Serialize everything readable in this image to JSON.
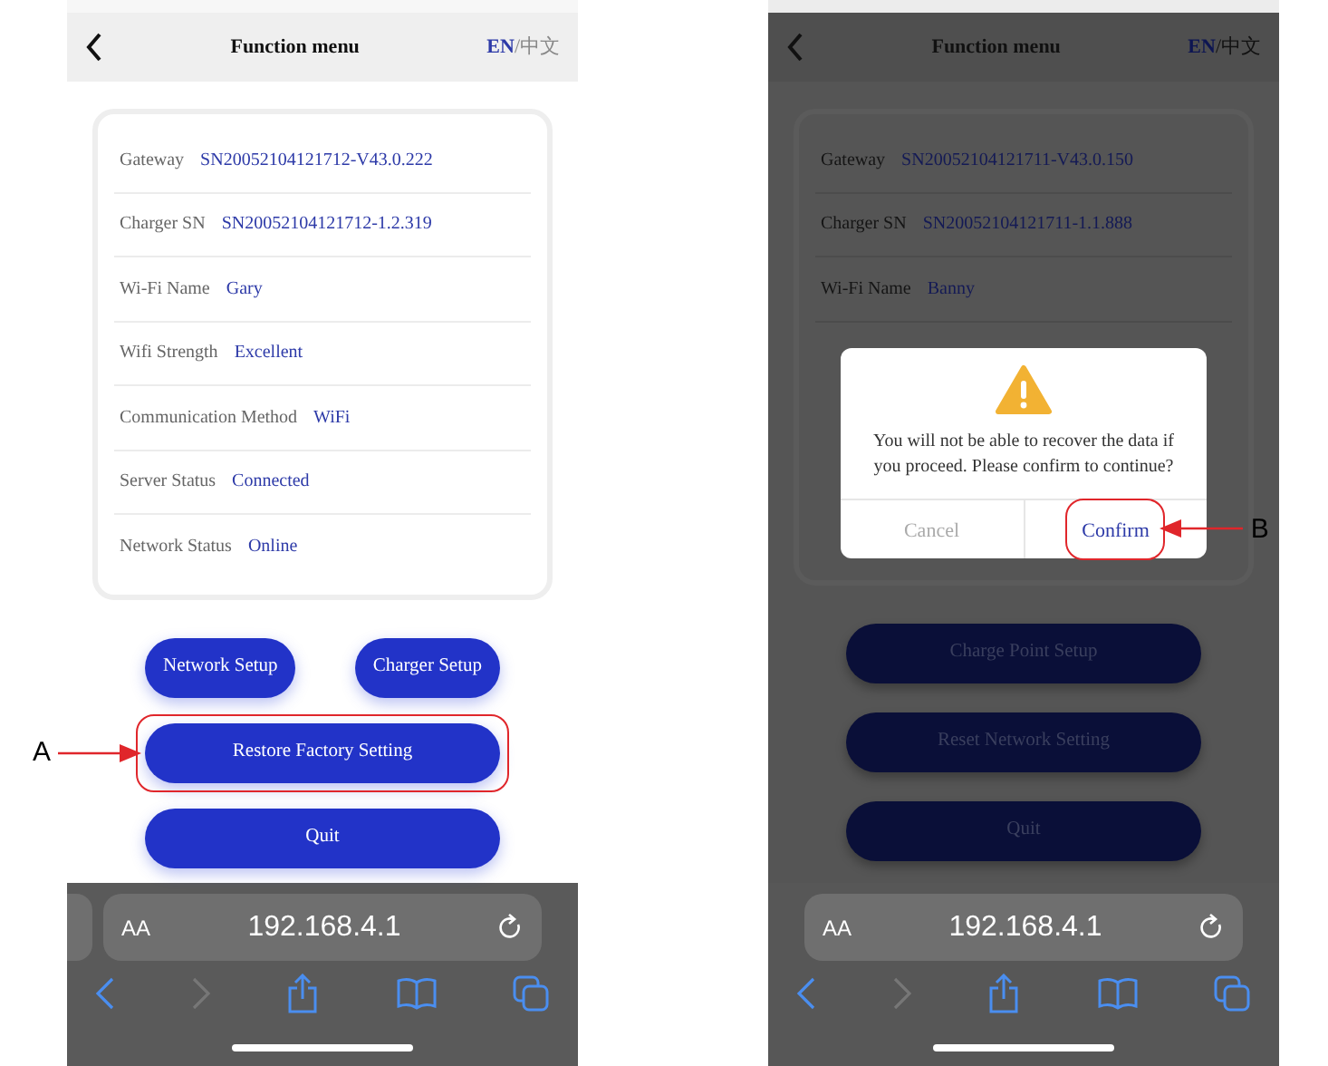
{
  "phones": [
    {
      "dimmed": false,
      "previous_tab_visible": true,
      "header": {
        "title": "Function menu",
        "separator": "/",
        "languages": [
          {
            "label": "EN",
            "selected": true
          },
          {
            "label": "中文",
            "selected": false
          }
        ]
      },
      "info_rows": [
        {
          "label": "Gateway",
          "value": "SN20052104121712-V43.0.222"
        },
        {
          "label": "Charger SN",
          "value": "SN20052104121712-1.2.319"
        },
        {
          "label": "Wi-Fi Name",
          "value": "Gary"
        },
        {
          "label": "Wifi Strength",
          "value": "Excellent"
        },
        {
          "label": "Communication Method",
          "value": "WiFi"
        },
        {
          "label": "Server Status",
          "value": "Connected"
        },
        {
          "label": "Network Status",
          "value": "Online"
        }
      ],
      "button_rows": [
        [
          {
            "label": "Network Setup"
          },
          {
            "label": "Charger Setup"
          }
        ],
        [
          {
            "label": "Restore Factory Setting",
            "callout": "A"
          }
        ],
        [
          {
            "label": "Quit"
          }
        ]
      ],
      "browser": {
        "text_size": "AA",
        "address": "192.168.4.1",
        "back_enabled": true,
        "forward_enabled": false
      }
    },
    {
      "dimmed": true,
      "previous_tab_visible": false,
      "header": {
        "title": "Function menu",
        "separator": "/",
        "languages": [
          {
            "label": "EN",
            "selected": true
          },
          {
            "label": "中文",
            "selected": false
          }
        ]
      },
      "info_rows": [
        {
          "label": "Gateway",
          "value": "SN20052104121711-V43.0.150"
        },
        {
          "label": "Charger SN",
          "value": "SN20052104121711-1.1.888"
        },
        {
          "label": "Wi-Fi Name",
          "value": "Banny"
        }
      ],
      "dialog": {
        "message": "You will not be able to recover the data if you proceed. Please confirm to continue?",
        "actions": [
          {
            "label": "Cancel",
            "kind": "cancel"
          },
          {
            "label": "Confirm",
            "kind": "confirm",
            "callout": "B"
          }
        ]
      },
      "button_rows": [
        [
          {
            "label": "Charge Point Setup"
          }
        ],
        [
          {
            "label": "Reset Network Setting"
          }
        ],
        [
          {
            "label": "Quit"
          }
        ]
      ],
      "browser": {
        "text_size": "AA",
        "address": "192.168.4.1",
        "back_enabled": true,
        "forward_enabled": false
      }
    }
  ]
}
